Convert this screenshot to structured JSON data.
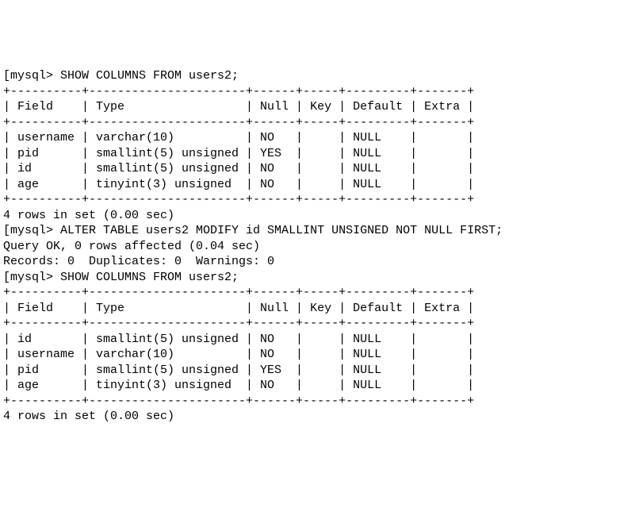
{
  "prompt_prefix": "[mysql> ",
  "commands": {
    "show1": "SHOW COLUMNS FROM users2;",
    "alter": "ALTER TABLE users2 MODIFY id SMALLINT UNSIGNED NOT NULL FIRST;",
    "show2": "SHOW COLUMNS FROM users2;"
  },
  "table_header": {
    "field": "Field",
    "type": "Type",
    "null": "Null",
    "key": "Key",
    "default": "Default",
    "extra": "Extra"
  },
  "border": "+----------+----------------------+------+-----+---------+-------+",
  "table1": {
    "rows": [
      {
        "field": "username",
        "type": "varchar(10)",
        "null": "NO",
        "key": "",
        "default": "NULL",
        "extra": ""
      },
      {
        "field": "pid",
        "type": "smallint(5) unsigned",
        "null": "YES",
        "key": "",
        "default": "NULL",
        "extra": ""
      },
      {
        "field": "id",
        "type": "smallint(5) unsigned",
        "null": "NO",
        "key": "",
        "default": "NULL",
        "extra": ""
      },
      {
        "field": "age",
        "type": "tinyint(3) unsigned",
        "null": "NO",
        "key": "",
        "default": "NULL",
        "extra": ""
      }
    ],
    "footer": "4 rows in set (0.00 sec)"
  },
  "alter_result": {
    "line1": "Query OK, 0 rows affected (0.04 sec)",
    "line2": "Records: 0  Duplicates: 0  Warnings: 0"
  },
  "table2": {
    "rows": [
      {
        "field": "id",
        "type": "smallint(5) unsigned",
        "null": "NO",
        "key": "",
        "default": "NULL",
        "extra": ""
      },
      {
        "field": "username",
        "type": "varchar(10)",
        "null": "NO",
        "key": "",
        "default": "NULL",
        "extra": ""
      },
      {
        "field": "pid",
        "type": "smallint(5) unsigned",
        "null": "YES",
        "key": "",
        "default": "NULL",
        "extra": ""
      },
      {
        "field": "age",
        "type": "tinyint(3) unsigned",
        "null": "NO",
        "key": "",
        "default": "NULL",
        "extra": ""
      }
    ],
    "footer": "4 rows in set (0.00 sec)"
  },
  "col_widths": {
    "field": 8,
    "type": 20,
    "null": 4,
    "key": 3,
    "default": 7,
    "extra": 5
  }
}
